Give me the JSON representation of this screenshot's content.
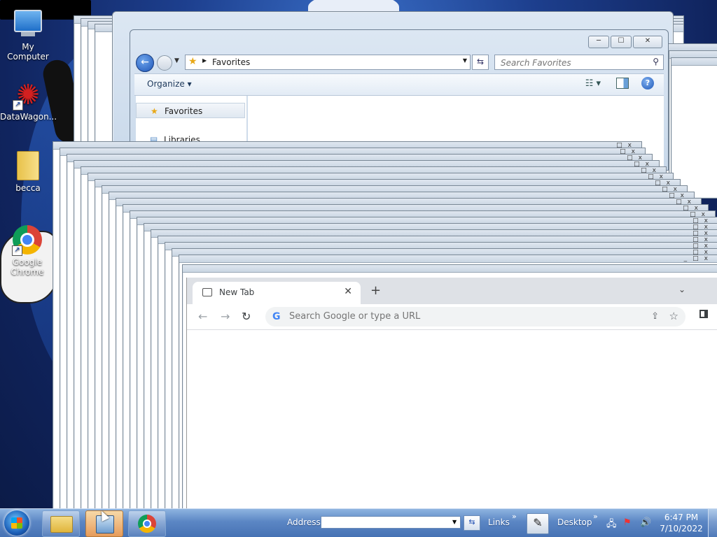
{
  "desktop": {
    "icons": [
      {
        "label": "My Computer"
      },
      {
        "label": "DataWagon..."
      },
      {
        "label": "becca"
      },
      {
        "label": "Google Chrome"
      }
    ]
  },
  "explorer": {
    "controls": {
      "minimize": "─",
      "maximize": "☐",
      "close": "✕"
    },
    "address": "Favorites",
    "search_placeholder": "Search Favorites",
    "organize_label": "Organize",
    "nav_items": [
      {
        "label": "Favorites"
      },
      {
        "label": "Libraries"
      }
    ]
  },
  "chrome": {
    "tab_title": "New Tab",
    "omnibox_placeholder": "Search Google or type a URL"
  },
  "taskbar": {
    "address_label": "Address",
    "links_label": "Links",
    "desktop_label": "Desktop",
    "time": "6:47 PM",
    "date": "7/10/2022",
    "chevron": "»"
  },
  "colors": {
    "accent": "#1e55b8",
    "taskbar": "#5b86c4",
    "chrome_tabstrip": "#dee1e6"
  }
}
